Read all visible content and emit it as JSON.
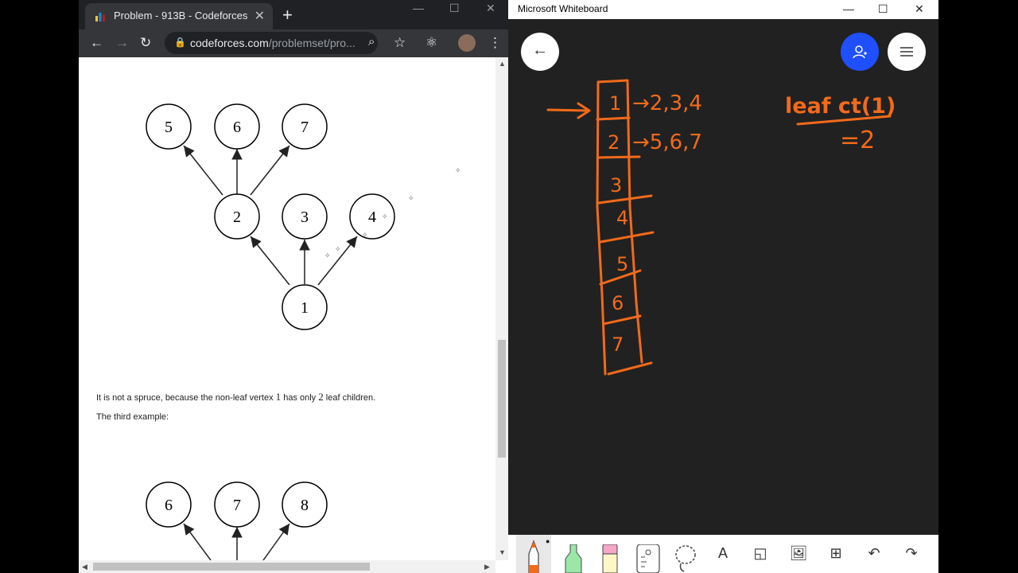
{
  "browser": {
    "tab_title": "Problem - 913B - Codeforces",
    "url_domain": "codeforces.com",
    "url_path": "/problemset/pro...",
    "controls": {
      "minimize": "—",
      "maximize": "☐",
      "close": "✕"
    }
  },
  "problem": {
    "tree_a": {
      "nodes": [
        "1",
        "2",
        "3",
        "4",
        "5",
        "6",
        "7"
      ]
    },
    "note_before": "It is not a spruce, because the non-leaf vertex ",
    "note_v": "1",
    "note_mid": " has only ",
    "note_n": "2",
    "note_after": " leaf children.",
    "third_example": "The third example:",
    "tree_b": {
      "nodes": [
        "6",
        "7",
        "8"
      ]
    }
  },
  "whiteboard": {
    "title": "Microsoft Whiteboard",
    "controls": {
      "minimize": "—",
      "maximize": "☐",
      "close": "✕"
    },
    "ink_text": {
      "cells": [
        "1",
        "2",
        "3",
        "4",
        "5",
        "6",
        "7"
      ],
      "row1": "→2,3,4",
      "row2": "→5,6,7",
      "note1": "leaf ct(1)",
      "note2": "=2"
    },
    "ink_color": "#f26a1b",
    "accent": "#1f4fff"
  }
}
